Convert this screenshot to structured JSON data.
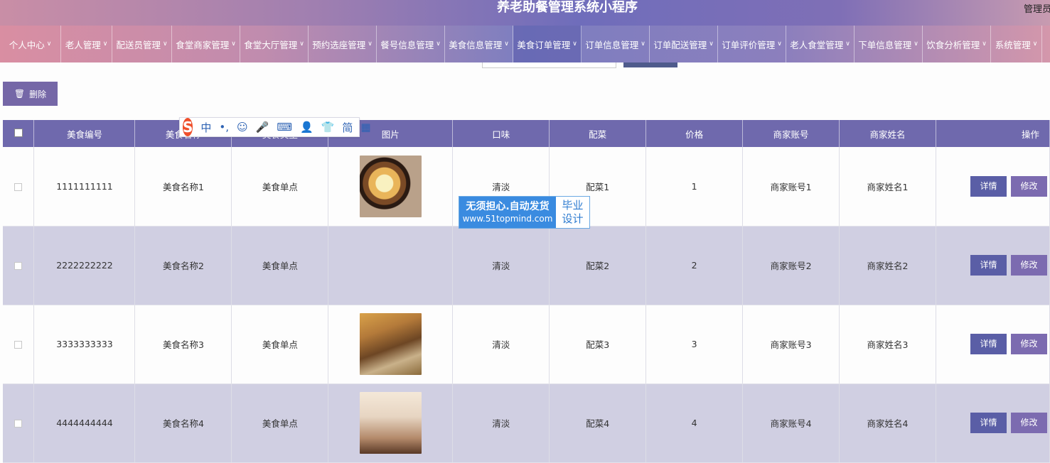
{
  "app": {
    "title": "养老助餐管理系统小程序",
    "admin_label": "管理员"
  },
  "nav": {
    "items": [
      {
        "label": "个人中心"
      },
      {
        "label": "老人管理"
      },
      {
        "label": "配送员管理"
      },
      {
        "label": "食堂商家管理"
      },
      {
        "label": "食堂大厅管理"
      },
      {
        "label": "预约选座管理"
      },
      {
        "label": "餐号信息管理"
      },
      {
        "label": "美食信息管理"
      },
      {
        "label": "美食订单管理"
      },
      {
        "label": "订单信息管理"
      },
      {
        "label": "订单配送管理"
      },
      {
        "label": "订单评价管理"
      },
      {
        "label": "老人食堂管理"
      },
      {
        "label": "下单信息管理"
      },
      {
        "label": "饮食分析管理"
      },
      {
        "label": "系统管理"
      }
    ]
  },
  "toolbar": {
    "delete_label": "删除"
  },
  "table": {
    "headers": [
      "美食编号",
      "美食名称",
      "美食类型",
      "图片",
      "口味",
      "配菜",
      "价格",
      "商家账号",
      "商家姓名",
      "操作"
    ],
    "rows": [
      {
        "code": "1111111111",
        "name": "美食名称1",
        "type": "美食单点",
        "taste": "清淡",
        "side": "配菜1",
        "price": "1",
        "account": "商家账号1",
        "owner": "商家姓名1"
      },
      {
        "code": "2222222222",
        "name": "美食名称2",
        "type": "美食单点",
        "taste": "清淡",
        "side": "配菜2",
        "price": "2",
        "account": "商家账号2",
        "owner": "商家姓名2"
      },
      {
        "code": "3333333333",
        "name": "美食名称3",
        "type": "美食单点",
        "taste": "清淡",
        "side": "配菜3",
        "price": "3",
        "account": "商家账号3",
        "owner": "商家姓名3"
      },
      {
        "code": "4444444444",
        "name": "美食名称4",
        "type": "美食单点",
        "taste": "清淡",
        "side": "配菜4",
        "price": "4",
        "account": "商家账号4",
        "owner": "商家姓名4"
      }
    ],
    "detail_label": "详情",
    "edit_label": "修改"
  },
  "ime": {
    "items": [
      "中",
      "•,",
      "☺",
      "🎤",
      "⌨",
      "👤",
      "👕",
      "简",
      "▦"
    ]
  },
  "watermark": {
    "main": "无须担心.自动发货",
    "url": "www.51topmind.com",
    "side_top": "毕业",
    "side_bottom": "设计"
  }
}
